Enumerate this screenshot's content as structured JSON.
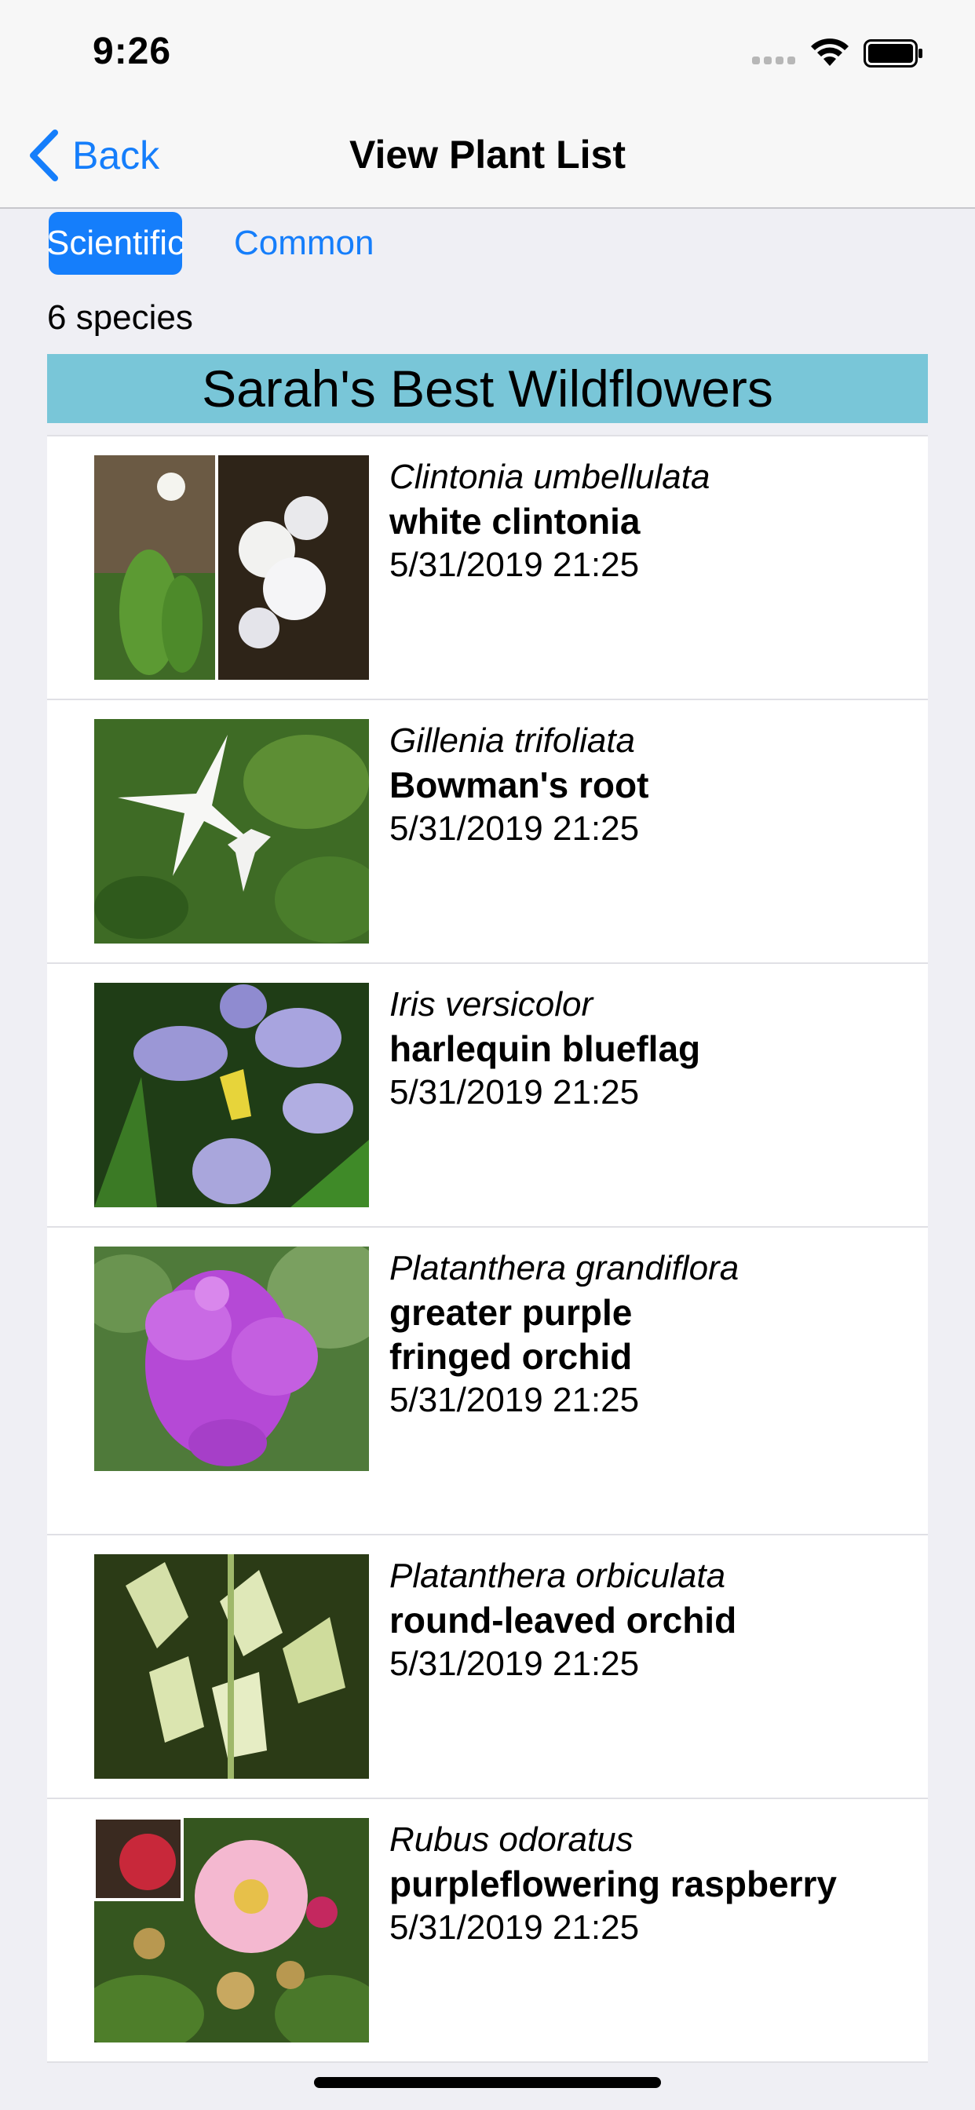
{
  "status": {
    "time": "9:26"
  },
  "nav": {
    "back_label": "Back",
    "title": "View Plant List"
  },
  "sort_buttons": {
    "scientific": "Scientific",
    "common": "Common"
  },
  "species_count": "6 species",
  "list_title": "Sarah's Best Wildflowers",
  "plants": [
    {
      "scientific": "Clintonia umbellulata",
      "common": "white clintonia",
      "date": "5/31/2019 21:25"
    },
    {
      "scientific": "Gillenia trifoliata",
      "common": "Bowman's root",
      "date": "5/31/2019 21:25"
    },
    {
      "scientific": "Iris versicolor",
      "common": "harlequin blueflag",
      "date": "5/31/2019 21:25"
    },
    {
      "scientific": "Platanthera grandiflora",
      "common": "greater purple fringed orchid",
      "date": "5/31/2019 21:25"
    },
    {
      "scientific": "Platanthera orbiculata",
      "common": "round-leaved orchid",
      "date": "5/31/2019 21:25"
    },
    {
      "scientific": "Rubus odoratus",
      "common": "purpleflowering raspberry",
      "date": "5/31/2019 21:25"
    }
  ],
  "icons": {
    "back": "chevron-left-icon",
    "signal": "cellular-signal-icon",
    "wifi": "wifi-icon",
    "battery": "battery-icon"
  },
  "colors": {
    "accent": "#157efb",
    "header_bar": "#79c6d8"
  }
}
